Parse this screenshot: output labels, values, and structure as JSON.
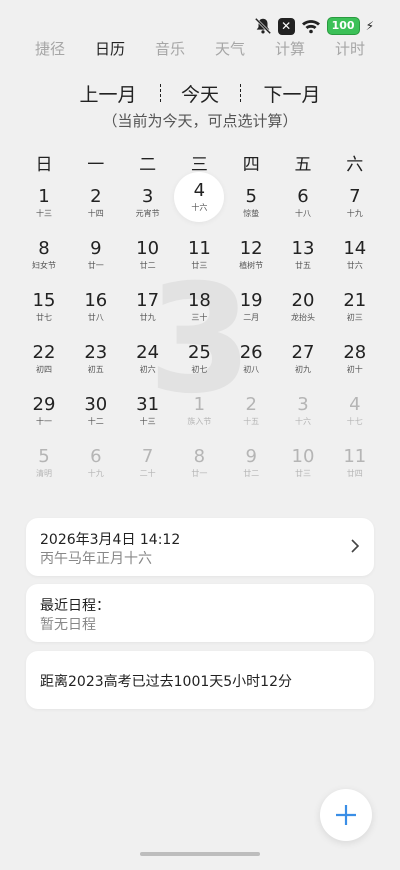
{
  "status_bar": {
    "icons": [
      "bell-off-icon",
      "close-badge-icon",
      "wifi-icon",
      "battery-icon",
      "charging-icon"
    ],
    "battery_text": "100",
    "close_symbol": "✕",
    "bolt_symbol": "⚡"
  },
  "tabs": [
    "捷径",
    "日历",
    "音乐",
    "天气",
    "计算",
    "计时"
  ],
  "active_tab": "日历",
  "nav": {
    "prev": "上一月",
    "today": "今天",
    "next": "下一月",
    "hint": "（当前为今天，可点选计算）"
  },
  "weekdays": [
    "日",
    "一",
    "二",
    "三",
    "四",
    "五",
    "六"
  ],
  "month_watermark": "3",
  "days": [
    {
      "d": "1",
      "l": "十三"
    },
    {
      "d": "2",
      "l": "十四"
    },
    {
      "d": "3",
      "l": "元宵节"
    },
    {
      "d": "4",
      "l": "十六",
      "today": true
    },
    {
      "d": "5",
      "l": "惊蛰"
    },
    {
      "d": "6",
      "l": "十八"
    },
    {
      "d": "7",
      "l": "十九"
    },
    {
      "d": "8",
      "l": "妇女节"
    },
    {
      "d": "9",
      "l": "廿一"
    },
    {
      "d": "10",
      "l": "廿二"
    },
    {
      "d": "11",
      "l": "廿三"
    },
    {
      "d": "12",
      "l": "植树节"
    },
    {
      "d": "13",
      "l": "廿五"
    },
    {
      "d": "14",
      "l": "廿六"
    },
    {
      "d": "15",
      "l": "廿七"
    },
    {
      "d": "16",
      "l": "廿八"
    },
    {
      "d": "17",
      "l": "廿九"
    },
    {
      "d": "18",
      "l": "三十"
    },
    {
      "d": "19",
      "l": "二月"
    },
    {
      "d": "20",
      "l": "龙抬头"
    },
    {
      "d": "21",
      "l": "初三"
    },
    {
      "d": "22",
      "l": "初四"
    },
    {
      "d": "23",
      "l": "初五"
    },
    {
      "d": "24",
      "l": "初六"
    },
    {
      "d": "25",
      "l": "初七"
    },
    {
      "d": "26",
      "l": "初八"
    },
    {
      "d": "27",
      "l": "初九"
    },
    {
      "d": "28",
      "l": "初十"
    },
    {
      "d": "29",
      "l": "十一"
    },
    {
      "d": "30",
      "l": "十二"
    },
    {
      "d": "31",
      "l": "十三"
    },
    {
      "d": "1",
      "l": "族入节",
      "other": true
    },
    {
      "d": "2",
      "l": "十五",
      "other": true
    },
    {
      "d": "3",
      "l": "十六",
      "other": true
    },
    {
      "d": "4",
      "l": "十七",
      "other": true
    },
    {
      "d": "5",
      "l": "清明",
      "other": true
    },
    {
      "d": "6",
      "l": "十九",
      "other": true
    },
    {
      "d": "7",
      "l": "二十",
      "other": true
    },
    {
      "d": "8",
      "l": "廿一",
      "other": true
    },
    {
      "d": "9",
      "l": "廿二",
      "other": true
    },
    {
      "d": "10",
      "l": "廿三",
      "other": true
    },
    {
      "d": "11",
      "l": "廿四",
      "other": true
    }
  ],
  "date_card": {
    "line1": "2026年3月4日  14:12",
    "line2": "丙午马年正月十六"
  },
  "schedule_card": {
    "title": "最近日程：",
    "value": "暂无日程"
  },
  "countdown_card": {
    "text": "距离2023高考已过去1001天5小时12分"
  },
  "fab_icon": "plus-icon",
  "colors": {
    "background": "#f0f0f0",
    "card": "#ffffff",
    "accent": "#3a8ee6",
    "battery": "#3cc158"
  }
}
